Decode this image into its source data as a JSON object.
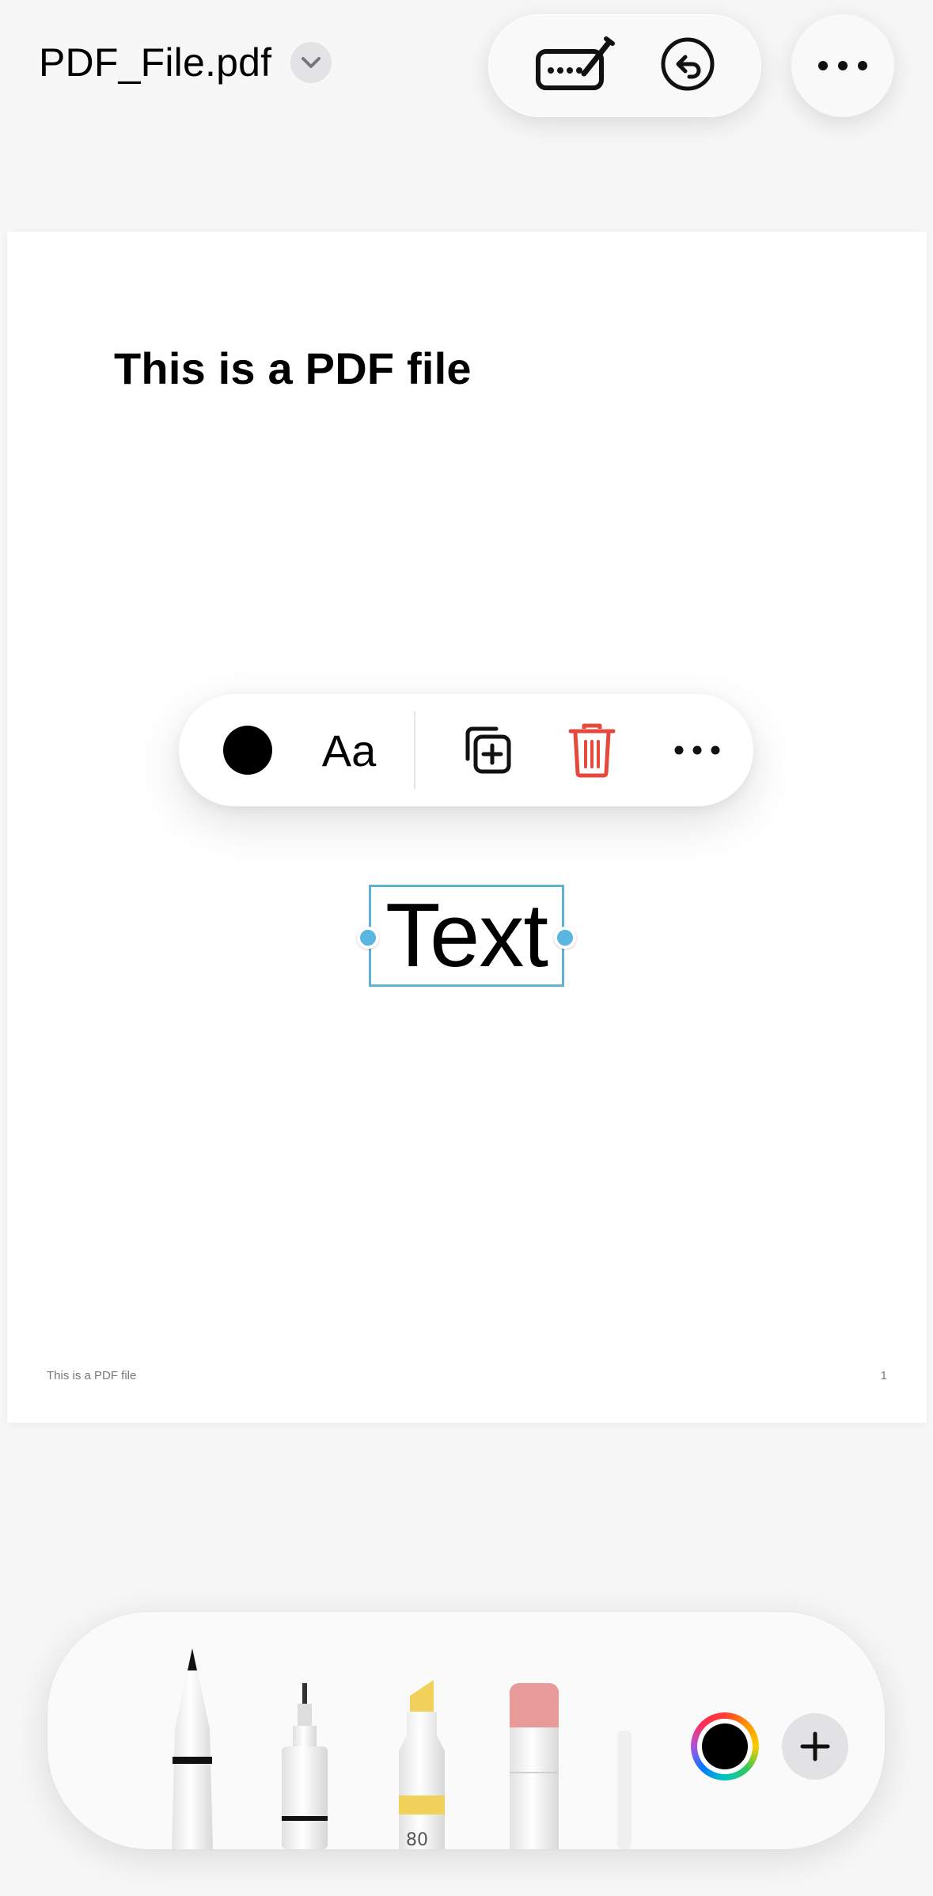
{
  "header": {
    "file_name": "PDF_File.pdf",
    "icons": {
      "chevron": "chevron-down-icon",
      "markup": "pencil-keyboard-icon",
      "undo": "undo-circle-icon",
      "more": "ellipsis-icon"
    }
  },
  "page": {
    "heading": "This is a PDF file",
    "footer_text": "This is a PDF file",
    "page_number": "1"
  },
  "context_menu": {
    "color": "#000000",
    "font_label": "Aa",
    "icons": [
      "color-dot-icon",
      "duplicate-icon",
      "trash-icon",
      "ellipsis-icon"
    ],
    "delete_color": "#e5483d"
  },
  "text_box": {
    "text": "Text"
  },
  "tool_palette": {
    "tools": [
      "pen",
      "fineliner",
      "highlighter",
      "eraser"
    ],
    "highlighter_label": "80",
    "current_color": "#000000",
    "accent_colors": {
      "highlighter": "#f2d15a",
      "eraser": "#e79a98"
    }
  }
}
